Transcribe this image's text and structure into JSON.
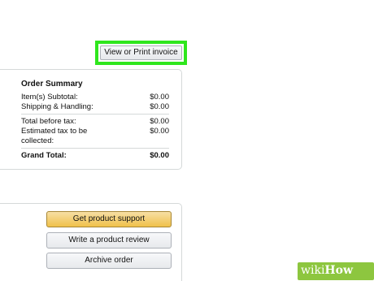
{
  "invoice": {
    "label": "View or Print invoice",
    "highlight_color": "#2fe61d"
  },
  "summary": {
    "title": "Order Summary",
    "rows": [
      {
        "label": "Item(s) Subtotal:",
        "value": "$0.00"
      },
      {
        "label": "Shipping & Handling:",
        "value": "$0.00"
      },
      {
        "label": "Total before tax:",
        "value": "$0.00"
      },
      {
        "label": "Estimated tax to be collected:",
        "value": "$0.00"
      }
    ],
    "grand_total": {
      "label": "Grand Total:",
      "value": "$0.00"
    }
  },
  "actions": {
    "support_label": "Get product support",
    "review_label": "Write a product review",
    "archive_label": "Archive order"
  },
  "watermark": {
    "prefix": "wiki",
    "suffix": "How",
    "color": "#8dc63f"
  }
}
